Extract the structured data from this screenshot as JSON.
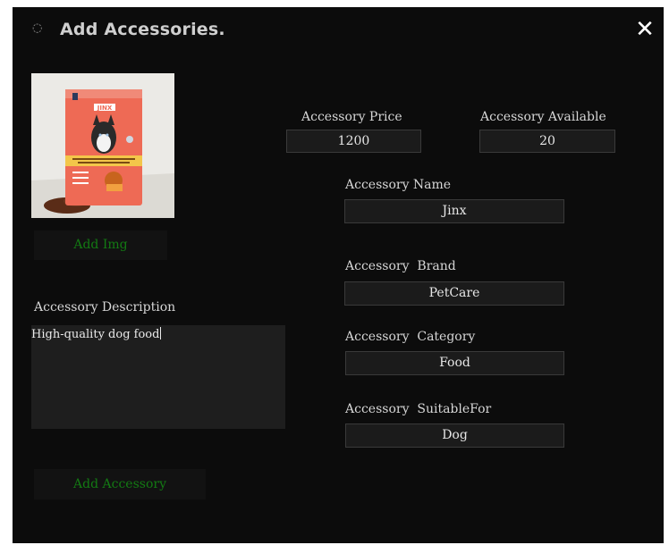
{
  "modal": {
    "title": "Add Accessories.",
    "title_icon": "spinner-icon",
    "close_icon": "close-icon"
  },
  "image": {
    "product_brand_text": "JINX",
    "add_img_label": "Add Img"
  },
  "description": {
    "label": "Accessory Description",
    "value": "High-quality dog food"
  },
  "fields": {
    "price": {
      "label": "Accessory Price",
      "value": "1200"
    },
    "available": {
      "label": "Accessory Available",
      "value": "20"
    },
    "name": {
      "label": "Accessory Name",
      "value": "Jinx"
    },
    "brand": {
      "label": "Accessory  Brand",
      "value": "PetCare"
    },
    "category": {
      "label": "Accessory  Category",
      "value": "Food"
    },
    "suitable_for": {
      "label": "Accessory  SuitableFor",
      "value": "Dog"
    }
  },
  "actions": {
    "add_accessory_label": "Add Accessory"
  },
  "colors": {
    "modal_bg": "#0c0c0c",
    "button_text": "#137a13",
    "bag": "#ee6a55"
  }
}
